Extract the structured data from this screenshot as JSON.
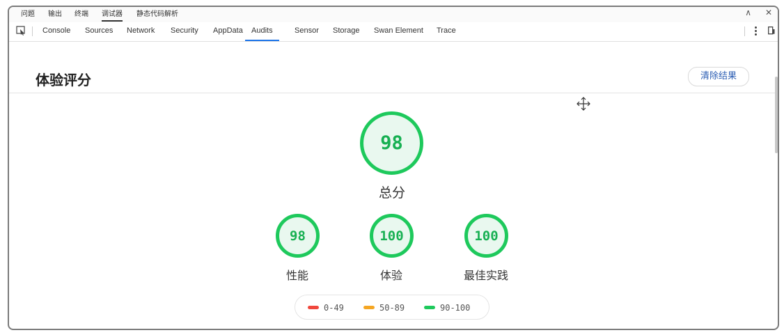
{
  "panel_tabs": [
    "问题",
    "输出",
    "终端",
    "调试器",
    "静态代码解析"
  ],
  "active_panel_tab": "调试器",
  "window_controls": {
    "collapse_icon": "chevron-up-icon",
    "close_icon": "close-icon"
  },
  "devtools": {
    "tabs": [
      "Console",
      "Sources",
      "Network",
      "Security",
      "AppData",
      "Audits",
      "Sensor",
      "Storage",
      "Swan Element",
      "Trace"
    ],
    "active_tab": "Audits"
  },
  "page": {
    "title": "体验评分",
    "clear_button": "清除结果"
  },
  "scores": {
    "overall": {
      "value": "98",
      "label": "总分"
    },
    "categories": [
      {
        "value": "98",
        "label": "性能"
      },
      {
        "value": "100",
        "label": "体验"
      },
      {
        "value": "100",
        "label": "最佳实践"
      }
    ]
  },
  "legend": [
    {
      "range": "0-49",
      "color": "#f0473c"
    },
    {
      "range": "50-89",
      "color": "#f5a623"
    },
    {
      "range": "90-100",
      "color": "#1ec95c"
    }
  ],
  "colors": {
    "pass": "#1ec95c",
    "accent": "#1a73e8",
    "button_text": "#2d5fb4"
  }
}
